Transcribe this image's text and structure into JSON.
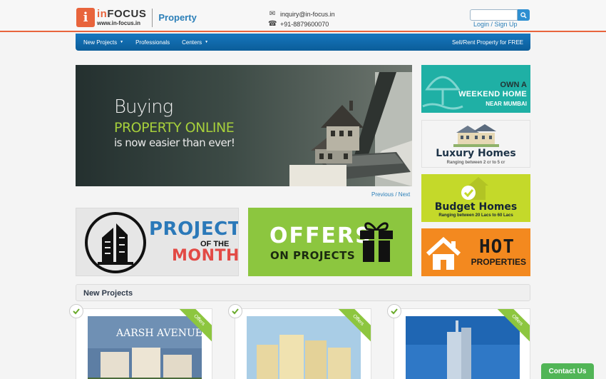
{
  "header": {
    "logo_letter": "i",
    "logo_brand_accent": "in",
    "logo_brand_rest": "FOCUS",
    "logo_url": "www.in-focus.in",
    "section_name": "Property",
    "email": "inquiry@in-focus.in",
    "phone": "+91-8879600070",
    "search_placeholder": "",
    "login_label": "Login",
    "auth_separator": " / ",
    "signup_label": "Sign Up"
  },
  "nav": {
    "items": [
      {
        "label": "New Projects",
        "dropdown": true
      },
      {
        "label": "Professionals",
        "dropdown": false
      },
      {
        "label": "Centers",
        "dropdown": true
      }
    ],
    "right_label": "Sell/Rent Property for FREE"
  },
  "hero": {
    "line1": "Buying",
    "line2": "PROPERTY ONLINE",
    "line3": "is now easier than ever!",
    "prev_label": "Previous",
    "nav_separator": " / ",
    "next_label": "Next"
  },
  "tiles": {
    "weekend": {
      "line1": "OWN A",
      "line2": "WEEKEND HOME",
      "line3": "NEAR MUMBAI"
    },
    "luxury": {
      "title": "Luxury Homes",
      "subtitle": "Ranging between 2 cr to 5 cr"
    },
    "budget": {
      "title": "Budget Homes",
      "subtitle": "Ranging between 20 Lacs to 60 Lacs"
    },
    "hot": {
      "line1": "HOT",
      "line2": "PROPERTIES"
    }
  },
  "promos": {
    "project": {
      "line1": "PROJECT",
      "line2": "OF THE",
      "line3": "MONTH"
    },
    "offers": {
      "line1": "OFFERS",
      "line2": "ON PROJECTS"
    }
  },
  "section": {
    "title": "New Projects"
  },
  "cards": [
    {
      "ribbon": "Offers",
      "image_label": "AARSH AVENUE"
    },
    {
      "ribbon": "Offers",
      "image_label": ""
    },
    {
      "ribbon": "Offers",
      "image_label": ""
    }
  ],
  "contact_button": "Contact Us",
  "colors": {
    "accent": "#e8643c",
    "nav_blue": "#0b5d99",
    "link_blue": "#2b7fb8",
    "green": "#8dc63f",
    "teal": "#1fb0a5",
    "lime": "#c4d92a",
    "orange": "#f3891f"
  },
  "icons": {
    "email": "envelope-icon",
    "phone": "phone-icon",
    "search": "search-icon",
    "check": "check-icon"
  }
}
